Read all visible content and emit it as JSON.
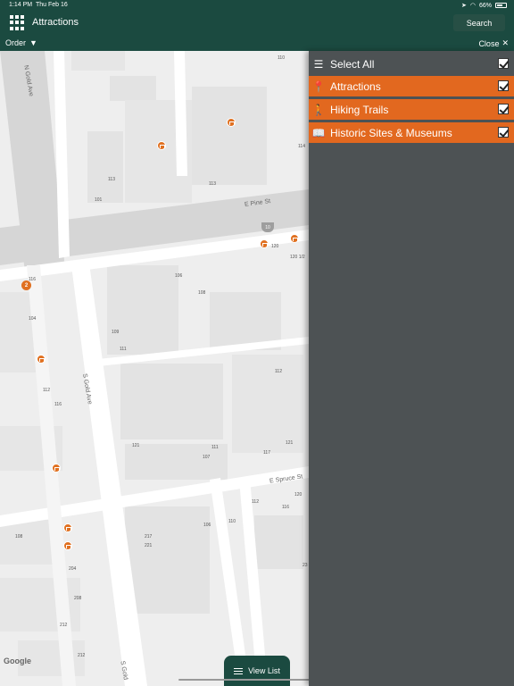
{
  "status_bar": {
    "time": "1:14 PM",
    "date": "Thu Feb 16",
    "battery": "66%"
  },
  "nav": {
    "title": "Attractions",
    "search_label": "Search"
  },
  "order_bar": {
    "order_label": "Order",
    "close_label": "Close"
  },
  "filter_panel": {
    "items": [
      {
        "label": "Select All",
        "icon": "list-icon",
        "checked": true
      },
      {
        "label": "Attractions",
        "icon": "map-pin-icon",
        "checked": true
      },
      {
        "label": "Hiking Trails",
        "icon": "hiker-icon",
        "checked": true
      },
      {
        "label": "Historic Sites & Museums",
        "icon": "book-icon",
        "checked": true
      }
    ]
  },
  "map": {
    "streets": [
      "N Gold Ave",
      "E Pine St",
      "S Gold Ave",
      "E Spruce St",
      "S Gold"
    ],
    "address_labels": [
      "110",
      "114",
      "113",
      "101",
      "113",
      "120",
      "120 1/2",
      "116",
      "106",
      "108",
      "104",
      "109",
      "111",
      "112",
      "116",
      "112",
      "121",
      "111",
      "107",
      "117",
      "121",
      "120",
      "112",
      "116",
      "110",
      "106",
      "217",
      "221",
      "108",
      "204",
      "208",
      "212",
      "212",
      "23"
    ],
    "cluster_count": "2",
    "highway_shield": "10",
    "attribution": "Google"
  },
  "view_list_label": "View List",
  "colors": {
    "nav_bg": "#1b4a40",
    "accent": "#e2681f",
    "panel_bg": "#4d5254"
  }
}
